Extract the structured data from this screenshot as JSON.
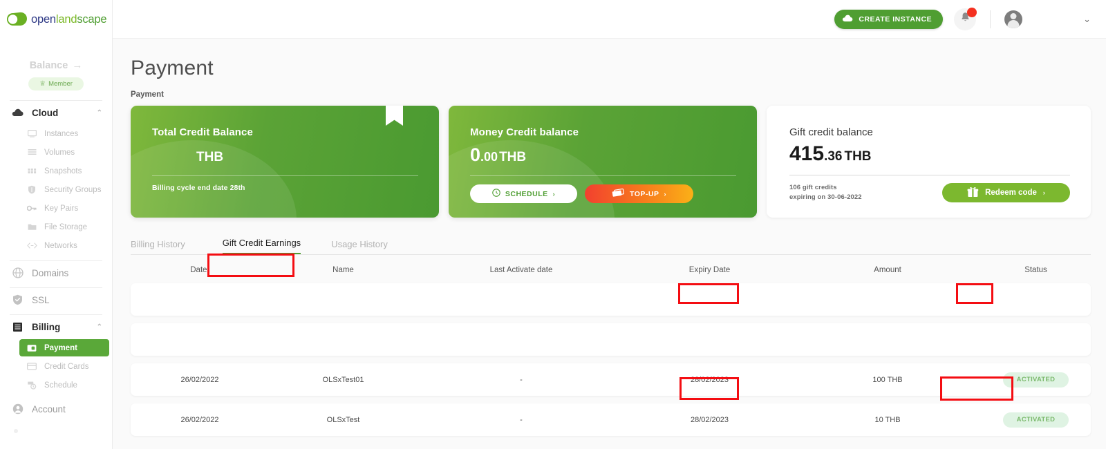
{
  "brand": {
    "name_open": "open",
    "name_land": "land",
    "name_scape": "scape"
  },
  "sidebar": {
    "balance_label": "Balance",
    "balance_arrow": "→",
    "member_badge": "Member",
    "crown_icon": "crown-icon",
    "groups": [
      {
        "label": "Cloud",
        "icon": "cloud-icon",
        "expanded": true,
        "items": [
          {
            "label": "Instances",
            "icon": "monitor-icon"
          },
          {
            "label": "Volumes",
            "icon": "layers-icon"
          },
          {
            "label": "Snapshots",
            "icon": "grid-icon"
          },
          {
            "label": "Security Groups",
            "icon": "shield-icon"
          },
          {
            "label": "Key Pairs",
            "icon": "key-icon"
          },
          {
            "label": "File Storage",
            "icon": "folder-icon"
          },
          {
            "label": "Networks",
            "icon": "code-icon"
          }
        ]
      },
      {
        "label": "Domains",
        "icon": "globe-icon",
        "expanded": false,
        "items": []
      },
      {
        "label": "SSL",
        "icon": "shield-check-icon",
        "expanded": false,
        "items": []
      },
      {
        "label": "Billing",
        "icon": "billing-icon",
        "expanded": true,
        "items": [
          {
            "label": "Payment",
            "icon": "wallet-icon",
            "active": true
          },
          {
            "label": "Credit Cards",
            "icon": "card-icon"
          },
          {
            "label": "Schedule",
            "icon": "calendar-clock-icon"
          }
        ]
      },
      {
        "label": "Account",
        "icon": "user-circle-icon",
        "expanded": false,
        "items": []
      }
    ]
  },
  "topbar": {
    "create_instance_label": "CREATE INSTANCE",
    "cloud_icon": "cloud-icon",
    "bell_icon": "bell-icon",
    "avatar_icon": "avatar",
    "chevron_icon": "chevron-down-icon"
  },
  "page": {
    "title": "Payment",
    "breadcrumb": "Payment"
  },
  "cards": {
    "total_credit": {
      "label": "Total Credit Balance",
      "amount": "",
      "currency": "THB",
      "note": "Billing cycle end date 28th"
    },
    "money_credit": {
      "label": "Money Credit balance",
      "whole": "0",
      "decimal": ".00",
      "currency": "THB",
      "schedule_label": "SCHEDULE",
      "schedule_icon": "clock-icon",
      "topup_label": "TOP-UP",
      "topup_icon": "cards-icon",
      "arrow": "›"
    },
    "gift_credit": {
      "label": "Gift credit balance",
      "whole": "415",
      "decimal": ".36",
      "currency": "THB",
      "sub_line1": "106 gift credits",
      "sub_line2": "expiring on 30-06-2022",
      "redeem_label": "Redeem code",
      "redeem_icon": "gift-icon",
      "arrow": "›"
    }
  },
  "tabs": [
    {
      "label": "Billing History",
      "active": false
    },
    {
      "label": "Gift Credit Earnings",
      "active": true
    },
    {
      "label": "Usage History",
      "active": false
    }
  ],
  "table": {
    "columns": [
      "Date.",
      "Name",
      "Last Activate date",
      "Expiry Date",
      "Amount",
      "Status"
    ],
    "rows": [
      {
        "date": "",
        "name": "",
        "last_activate": "",
        "expiry": "",
        "amount": "",
        "status": ""
      },
      {
        "date": "",
        "name": "",
        "last_activate": "",
        "expiry": "",
        "amount": "",
        "status": ""
      },
      {
        "date": "26/02/2022",
        "name": "OLSxTest01",
        "last_activate": "-",
        "expiry": "28/02/2023",
        "amount": "100 THB",
        "status": "ACTIVATED"
      },
      {
        "date": "26/02/2022",
        "name": "OLSxTest",
        "last_activate": "-",
        "expiry": "28/02/2023",
        "amount": "10 THB",
        "status": "ACTIVATED"
      }
    ]
  },
  "colors": {
    "brand_green": "#4f9e32",
    "light_green": "#7cb82f",
    "topup_orange": "#f77c1c",
    "annotation_red": "#f40d12",
    "status_bg": "#dff3e3",
    "status_text": "#7ab96b"
  }
}
